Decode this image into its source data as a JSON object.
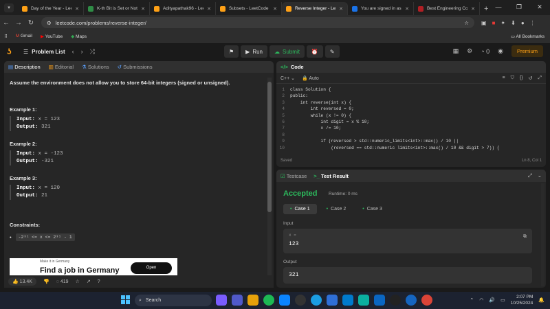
{
  "browser": {
    "tabs": [
      {
        "title": "Day of the Year - Lee",
        "color": "#ffa116",
        "active": false
      },
      {
        "title": "K-th Bit is Set or Not",
        "color": "#2f8d46",
        "active": false
      },
      {
        "title": "Adityapathak96 - Lee",
        "color": "#ffa116",
        "active": false
      },
      {
        "title": "Subsets - LeetCode",
        "color": "#ffa116",
        "active": false
      },
      {
        "title": "Reverse Integer - Lee",
        "color": "#ffa116",
        "active": true
      },
      {
        "title": "You are signed in as",
        "color": "#1a73e8",
        "active": false
      },
      {
        "title": "Best Engineering Co",
        "color": "#b11f24",
        "active": false
      }
    ],
    "url": "leetcode.com/problems/reverse-integer/",
    "bookmarks": [
      "Gmail",
      "YouTube",
      "Maps"
    ],
    "all_bookmarks": "All Bookmarks"
  },
  "header": {
    "problem_list": "Problem List",
    "run": "Run",
    "submit": "Submit",
    "streak": "0",
    "premium": "Premium"
  },
  "left": {
    "tabs": [
      "Description",
      "Editorial",
      "Solutions",
      "Submissions"
    ],
    "assumption": "Assume the environment does not allow you to store 64-bit integers (signed or unsigned).",
    "examples": [
      {
        "title": "Example 1:",
        "input": "x = 123",
        "output": "321"
      },
      {
        "title": "Example 2:",
        "input": "x = -123",
        "output": "-321"
      },
      {
        "title": "Example 3:",
        "input": "x = 120",
        "output": "21"
      }
    ],
    "input_label": "Input:",
    "output_label": "Output:",
    "constraints_title": "Constraints:",
    "constraint": "-2³¹ <= x <= 2³¹ - 1",
    "ad": {
      "small": "Make it in Germany",
      "title": "Find a job in Germany",
      "button": "Open"
    },
    "footer": {
      "likes": "13.4K",
      "comments": "419"
    }
  },
  "code": {
    "title": "Code",
    "language": "C++",
    "mode": "Auto",
    "lines": [
      "class Solution {",
      "public:",
      "    int reverse(int x) {",
      "        int reversed = 0;",
      "        while (x != 0) {",
      "            int digit = x % 10;",
      "            x /= 10;",
      "",
      "            if (reversed > std::numeric_limits<int>::max() / 10 ||",
      "                (reversed == std::numeric limits<int>::max() / 10 && digit > 7)) {"
    ],
    "saved": "Saved",
    "position": "Ln 8, Col 1"
  },
  "test": {
    "tabs": [
      "Testcase",
      "Test Result"
    ],
    "status": "Accepted",
    "runtime": "Runtime: 0 ms",
    "cases": [
      "Case 1",
      "Case 2",
      "Case 3"
    ],
    "input_label": "Input",
    "var_name": "x =",
    "input_value": "123",
    "output_label": "Output",
    "output_value": "321"
  },
  "taskbar": {
    "search": "Search",
    "time": "2:07 PM",
    "date": "10/25/2024"
  }
}
